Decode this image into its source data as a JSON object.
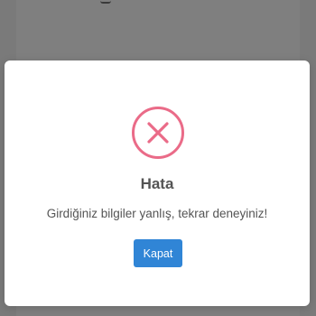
{
  "modal": {
    "icon": "error-x-icon",
    "title": "Hata",
    "message": "Girdiğiniz bilgiler yanlış, tekrar deneyiniz!",
    "confirm_label": "Kapat"
  },
  "colors": {
    "icon_red": "#ea6b88",
    "button_blue": "#3085d6",
    "text": "#545454",
    "backdrop": "#7d7d7d"
  }
}
